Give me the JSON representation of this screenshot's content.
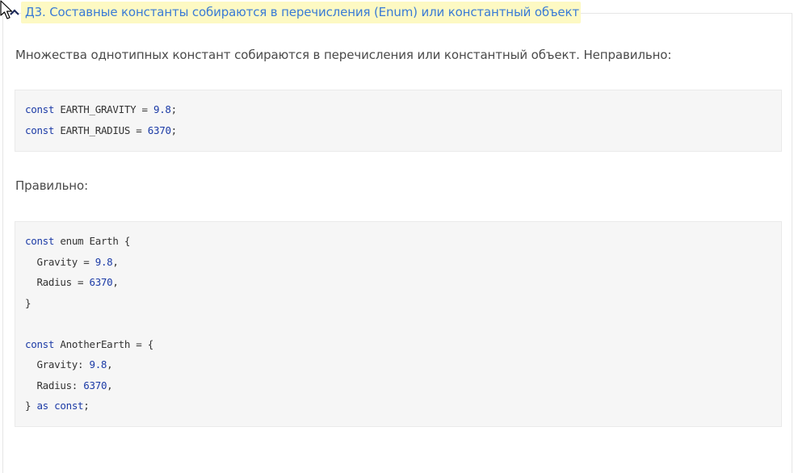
{
  "summary": {
    "title": "Д3. Составные константы собираются в перечисления (Enum) или константный объект"
  },
  "intro_text": "Множества однотипных констант собираются в перечисления или константный объект. Неправильно:",
  "correct_label": "Правильно:",
  "code_wrong": [
    [
      {
        "t": "const",
        "c": "kw"
      },
      {
        "t": " EARTH_GRAVITY = ",
        "c": ""
      },
      {
        "t": "9.8",
        "c": "num"
      },
      {
        "t": ";",
        "c": ""
      }
    ],
    [
      {
        "t": "const",
        "c": "kw"
      },
      {
        "t": " EARTH_RADIUS = ",
        "c": ""
      },
      {
        "t": "6370",
        "c": "num"
      },
      {
        "t": ";",
        "c": ""
      }
    ]
  ],
  "code_right": [
    [
      {
        "t": "const",
        "c": "kw"
      },
      {
        "t": " enum Earth {",
        "c": ""
      }
    ],
    [
      {
        "t": "  Gravity = ",
        "c": ""
      },
      {
        "t": "9.8",
        "c": "num"
      },
      {
        "t": ",",
        "c": ""
      }
    ],
    [
      {
        "t": "  Radius = ",
        "c": ""
      },
      {
        "t": "6370",
        "c": "num"
      },
      {
        "t": ",",
        "c": ""
      }
    ],
    [
      {
        "t": "}",
        "c": ""
      }
    ],
    [],
    [
      {
        "t": "const",
        "c": "kw"
      },
      {
        "t": " AnotherEarth = {",
        "c": ""
      }
    ],
    [
      {
        "t": "  Gravity: ",
        "c": ""
      },
      {
        "t": "9.8",
        "c": "num"
      },
      {
        "t": ",",
        "c": ""
      }
    ],
    [
      {
        "t": "  Radius: ",
        "c": ""
      },
      {
        "t": "6370",
        "c": "num"
      },
      {
        "t": ",",
        "c": ""
      }
    ],
    [
      {
        "t": "} ",
        "c": ""
      },
      {
        "t": "as",
        "c": "kw"
      },
      {
        "t": " ",
        "c": ""
      },
      {
        "t": "const",
        "c": "kw"
      },
      {
        "t": ";",
        "c": ""
      }
    ]
  ],
  "colors": {
    "link": "#3a7bd5",
    "highlight": "#fdf9c3",
    "keyword": "#1c3ba6",
    "code_bg": "#f6f6f6"
  },
  "icons": [
    "chevron-up-icon",
    "mouse-pointer-icon"
  ]
}
